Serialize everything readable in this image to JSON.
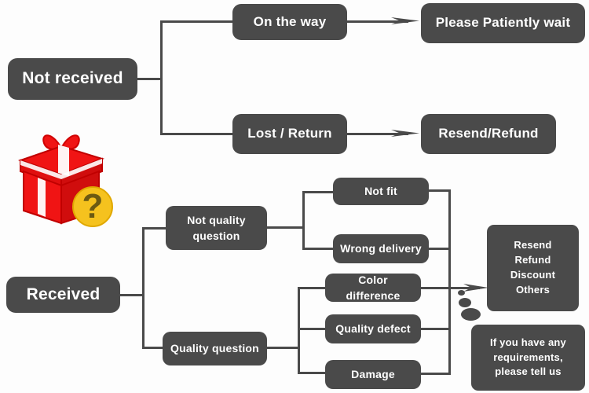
{
  "diagram": {
    "title": "Order issue resolution flowchart",
    "colors": {
      "node_fill": "#4a4a4a",
      "node_text": "#ffffff",
      "connector": "#4a4a4a",
      "background": "#fdfdfd",
      "gift_red": "#f01414",
      "gift_dark_red": "#c00000",
      "badge_yellow": "#f5c21e",
      "badge_question": "#6b5a12"
    }
  },
  "nodes": {
    "not_received": {
      "label": "Not received"
    },
    "on_the_way": {
      "label": "On the way"
    },
    "please_wait": {
      "label": "Please Patiently wait"
    },
    "lost_return": {
      "label": "Lost / Return"
    },
    "resend_refund": {
      "label": "Resend/Refund"
    },
    "received": {
      "label": "Received"
    },
    "not_quality_question": {
      "line1": "Not quality",
      "line2": "question"
    },
    "quality_question": {
      "label": "Quality question"
    },
    "not_fit": {
      "label": "Not fit"
    },
    "wrong_delivery": {
      "label": "Wrong delivery"
    },
    "color_difference": {
      "label": "Color difference"
    },
    "quality_defect": {
      "label": "Quality defect"
    },
    "damage": {
      "label": "Damage"
    },
    "outcomes": {
      "line1": "Resend",
      "line2": "Refund",
      "line3": "Discount",
      "line4": "Others"
    },
    "requirements_note": {
      "line1": "If you have any",
      "line2": "requirements,",
      "line3": "please tell us"
    }
  },
  "icons": {
    "gift_box": "gift-box-with-question-mark-icon"
  }
}
